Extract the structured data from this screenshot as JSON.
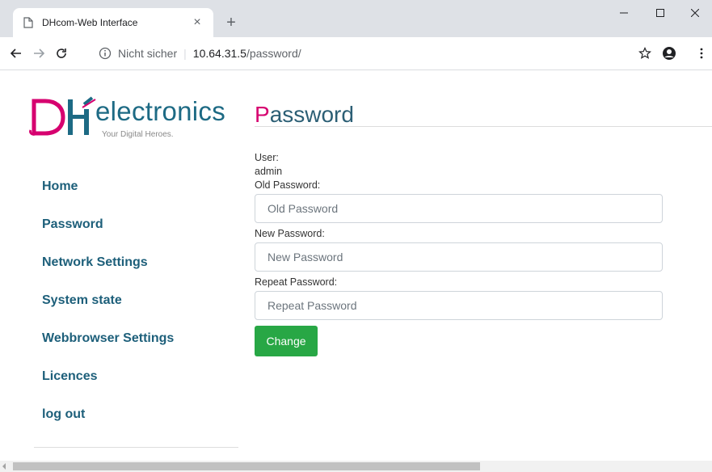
{
  "browser": {
    "tab_title": "DHcom-Web Interface",
    "tab_close": "×",
    "new_tab": "+",
    "insecure_label": "Nicht sicher",
    "separator": "|",
    "url_host": "10.64.31.5",
    "url_path": "/password/"
  },
  "logo": {
    "main": "electronics",
    "tagline": "Your Digital Heroes."
  },
  "nav": {
    "items": [
      "Home",
      "Password",
      "Network Settings",
      "System state",
      "Webbrowser Settings",
      "Licences",
      "log out"
    ]
  },
  "main": {
    "heading_first": "P",
    "heading_rest": "assword",
    "user_label": "User:",
    "user_value": "admin",
    "old_label": "Old Password:",
    "old_placeholder": "Old Password",
    "new_label": "New Password:",
    "new_placeholder": "New Password",
    "repeat_label": "Repeat Password:",
    "repeat_placeholder": "Repeat Password",
    "submit_label": "Change"
  },
  "colors": {
    "brand_pink": "#d6006f",
    "brand_teal": "#1d6a84",
    "button_green": "#28a745"
  }
}
